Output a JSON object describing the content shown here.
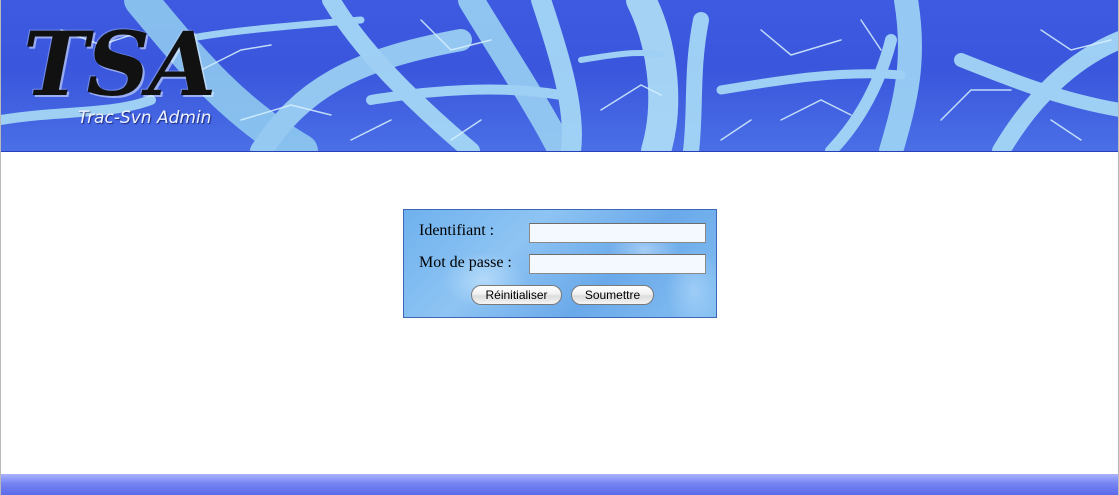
{
  "header": {
    "logo_text": "TSA",
    "logo_subtitle": "Trac-Svn Admin"
  },
  "login_form": {
    "username_label": "Identifiant :",
    "username_value": "",
    "password_label": "Mot de passe :",
    "password_value": "",
    "reset_button_label": "Réinitialiser",
    "submit_button_label": "Soumettre"
  },
  "colors": {
    "banner_blue": "#3d5ae0",
    "form_blue": "#7ab8ef",
    "footer_blue": "#6f7ef0"
  }
}
